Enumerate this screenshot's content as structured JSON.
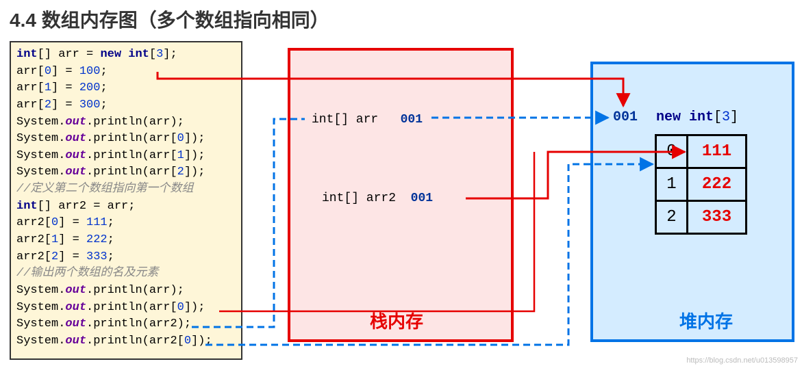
{
  "title": "4.4 数组内存图（多个数组指向相同）",
  "code": {
    "l1_a": "int",
    "l1_b": "[] arr = ",
    "l1_c": "new int",
    "l1_d": "[",
    "l1_e": "3",
    "l1_f": "];",
    "l2_a": "arr[",
    "l2_b": "0",
    "l2_c": "] = ",
    "l2_d": "100",
    "l2_e": ";",
    "l3_a": "arr[",
    "l3_b": "1",
    "l3_c": "] = ",
    "l3_d": "200",
    "l3_e": ";",
    "l4_a": "arr[",
    "l4_b": "2",
    "l4_c": "] = ",
    "l4_d": "300",
    "l4_e": ";",
    "l5_a": "System.",
    "l5_b": "out",
    "l5_c": ".println(arr);",
    "l6_a": "System.",
    "l6_b": "out",
    "l6_c": ".println(arr[",
    "l6_d": "0",
    "l6_e": "]);",
    "l7_a": "System.",
    "l7_b": "out",
    "l7_c": ".println(arr[",
    "l7_d": "1",
    "l7_e": "]);",
    "l8_a": "System.",
    "l8_b": "out",
    "l8_c": ".println(arr[",
    "l8_d": "2",
    "l8_e": "]);",
    "l9": "//定义第二个数组指向第一个数组",
    "l10_a": "int",
    "l10_b": "[] arr2 = arr;",
    "l11_a": "arr2[",
    "l11_b": "0",
    "l11_c": "] = ",
    "l11_d": "111",
    "l11_e": ";",
    "l12_a": "arr2[",
    "l12_b": "1",
    "l12_c": "] = ",
    "l12_d": "222",
    "l12_e": ";",
    "l13_a": "arr2[",
    "l13_b": "2",
    "l13_c": "] = ",
    "l13_d": "333",
    "l13_e": ";",
    "l14": "//输出两个数组的名及元素",
    "l15_a": "System.",
    "l15_b": "out",
    "l15_c": ".println(arr);",
    "l16_a": "System.",
    "l16_b": "out",
    "l16_c": ".println(arr[",
    "l16_d": "0",
    "l16_e": "]);",
    "l17_a": "System.",
    "l17_b": "out",
    "l17_c": ".println(arr2);",
    "l18_a": "System.",
    "l18_b": "out",
    "l18_c": ".println(arr2[",
    "l18_d": "0",
    "l18_e": "]);"
  },
  "stack": {
    "label": "栈内存",
    "var1_decl": "int[] arr",
    "var1_addr": "001",
    "var2_decl": "int[] arr2",
    "var2_addr": "001"
  },
  "heap": {
    "label": "堆内存",
    "addr": "001",
    "decl_a": "new int",
    "decl_b": "[",
    "decl_c": "3",
    "decl_d": "]",
    "cells": [
      {
        "idx": "0",
        "val": "111"
      },
      {
        "idx": "1",
        "val": "222"
      },
      {
        "idx": "2",
        "val": "333"
      }
    ]
  },
  "watermark": "https://blog.csdn.net/u013598957"
}
